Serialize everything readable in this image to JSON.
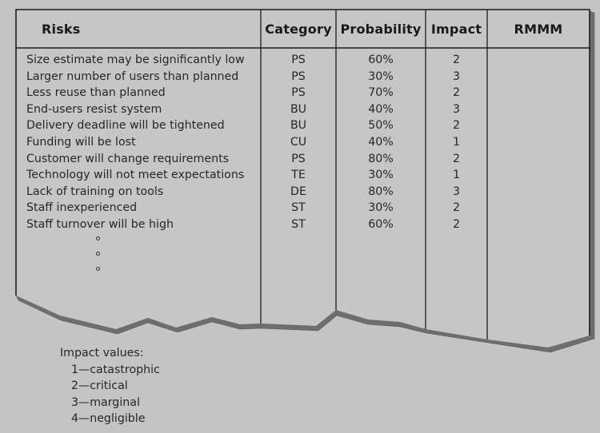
{
  "table": {
    "headers": {
      "risks": "Risks",
      "category": "Category",
      "probability": "Probability",
      "impact": "Impact",
      "rmmm": "RMMM"
    },
    "rows": [
      {
        "risk": "Size estimate may be significantly low",
        "category": "PS",
        "probability": "60%",
        "impact": "2",
        "rmmm": ""
      },
      {
        "risk": "Larger number of users than planned",
        "category": "PS",
        "probability": "30%",
        "impact": "3",
        "rmmm": ""
      },
      {
        "risk": "Less reuse than planned",
        "category": "PS",
        "probability": "70%",
        "impact": "2",
        "rmmm": ""
      },
      {
        "risk": "End-users resist system",
        "category": "BU",
        "probability": "40%",
        "impact": "3",
        "rmmm": ""
      },
      {
        "risk": "Delivery deadline will be tightened",
        "category": "BU",
        "probability": "50%",
        "impact": "2",
        "rmmm": ""
      },
      {
        "risk": "Funding will be lost",
        "category": "CU",
        "probability": "40%",
        "impact": "1",
        "rmmm": ""
      },
      {
        "risk": "Customer will change requirements",
        "category": "PS",
        "probability": "80%",
        "impact": "2",
        "rmmm": ""
      },
      {
        "risk": "Technology will not meet expectations",
        "category": "TE",
        "probability": "30%",
        "impact": "1",
        "rmmm": ""
      },
      {
        "risk": "Lack of training on tools",
        "category": "DE",
        "probability": "80%",
        "impact": "3",
        "rmmm": ""
      },
      {
        "risk": "Staff inexperienced",
        "category": "ST",
        "probability": "30%",
        "impact": "2",
        "rmmm": ""
      },
      {
        "risk": "Staff turnover will be high",
        "category": "ST",
        "probability": "60%",
        "impact": "2",
        "rmmm": ""
      }
    ],
    "continuation": "vertical-ellipsis"
  },
  "legend": {
    "title": "Impact values:",
    "items": [
      "1—catastrophic",
      "2—critical",
      "3—marginal",
      "4—negligible"
    ]
  }
}
